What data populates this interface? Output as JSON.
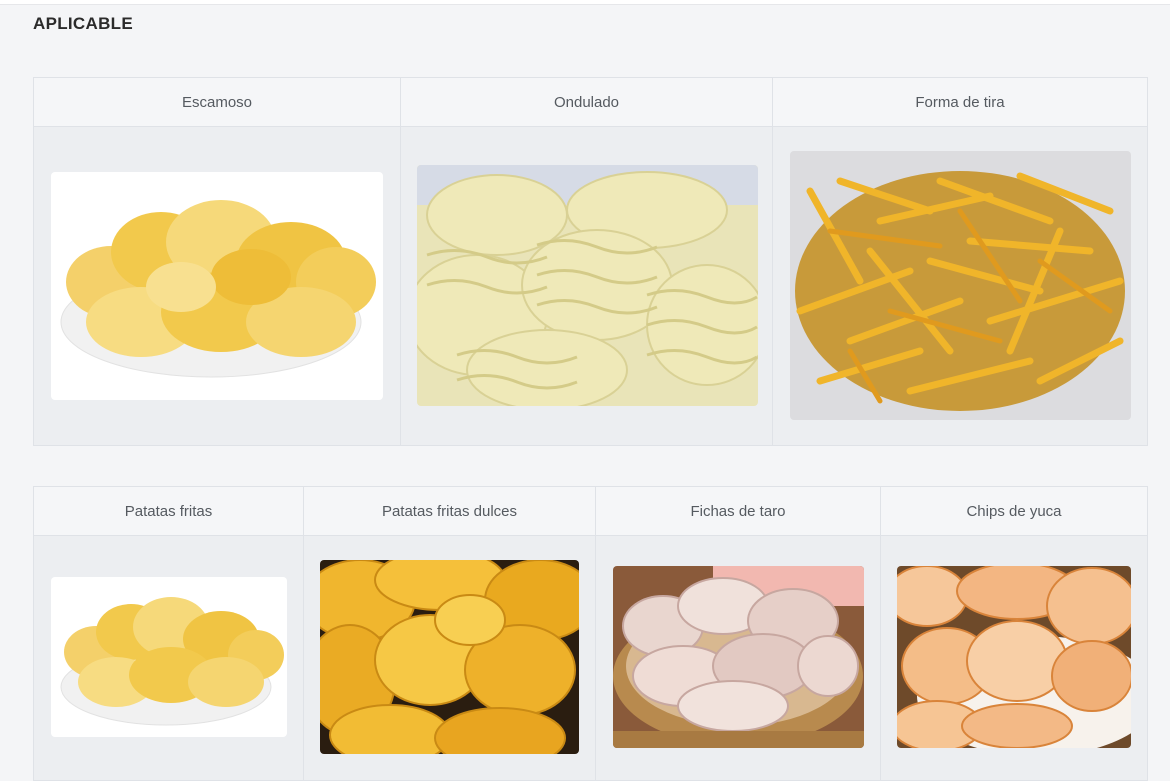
{
  "section": {
    "title": "APLICABLE"
  },
  "shapes": {
    "columns": [
      {
        "label": "Escamoso",
        "image": "flaky-potato-chips-on-plate"
      },
      {
        "label": "Ondulado",
        "image": "wavy-ridged-chips"
      },
      {
        "label": "Forma de tira",
        "image": "shoestring-potato-strips"
      }
    ]
  },
  "types": {
    "columns": [
      {
        "label": "Patatas fritas",
        "image": "potato-chips-on-plate"
      },
      {
        "label": "Patatas fritas dulces",
        "image": "sweet-potato-chips"
      },
      {
        "label": "Fichas de taro",
        "image": "taro-chips-in-basket"
      },
      {
        "label": "Chips de yuca",
        "image": "cassava-chips"
      }
    ]
  },
  "colors": {
    "page_background": "#f4f5f7",
    "cell_background": "#eceef1",
    "header_background": "#f5f6f8",
    "border": "#dfe2e7",
    "chip_yellow": "#f2c94c",
    "sweet_potato_orange": "#e6a61c"
  }
}
